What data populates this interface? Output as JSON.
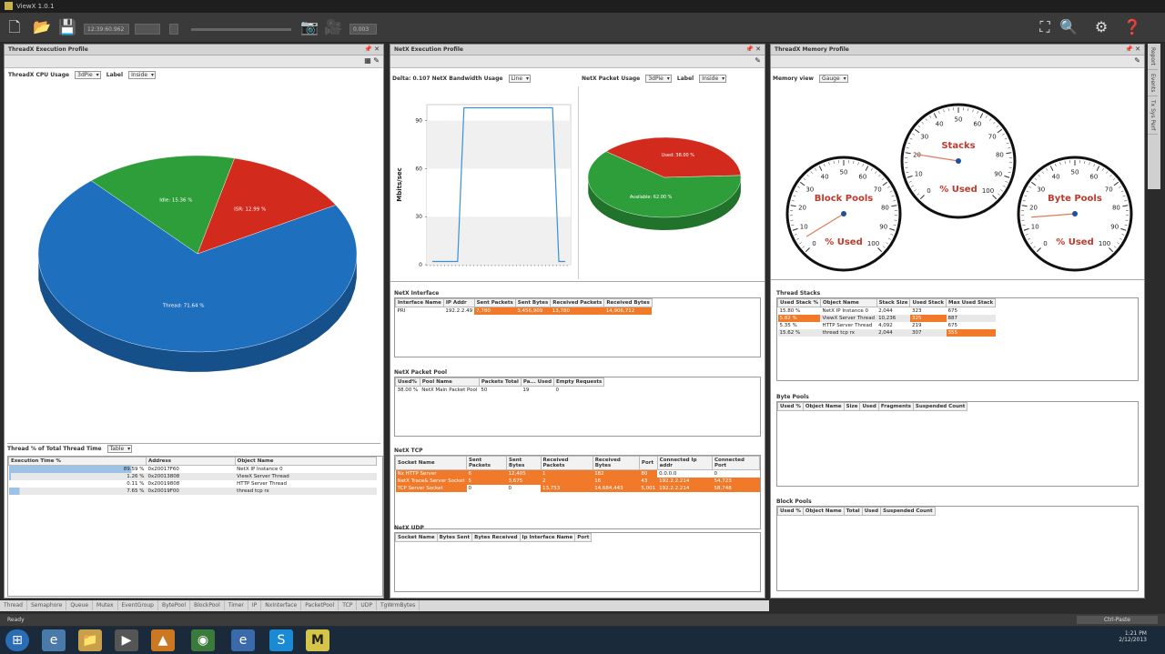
{
  "window": {
    "title": "ViewX 1.0.1"
  },
  "toolbar": {
    "field1": "12:39:60.962",
    "field2": "0.003"
  },
  "exec_panel": {
    "title": "ThreadX Execution Profile",
    "cpu_label": "ThreadX CPU Usage",
    "chart_type": "3dPie",
    "label_label": "Label",
    "label_value": "Inside",
    "pie": {
      "slices": [
        {
          "name": "Thread: 71.64 %",
          "value": 71.64,
          "color": "#1f6fbf"
        },
        {
          "name": "Idle: 15.36 %",
          "value": 15.36,
          "color": "#2e9e3a"
        },
        {
          "name": "ISR: 12.99 %",
          "value": 12.99,
          "color": "#d32a1e"
        }
      ]
    },
    "table_label": "Thread % of Total Thread Time",
    "table_type": "Table",
    "columns": [
      "Execution Time %",
      "Address",
      "Object Name"
    ],
    "rows": [
      [
        "89.59 %",
        "0x20017F60",
        "NetX IP Instance 0"
      ],
      [
        "1.26 %",
        "0x20013808",
        "ViewX Server Thread"
      ],
      [
        "0.11 %",
        "0x20019808",
        "HTTP Server Thread"
      ],
      [
        "7.65 %",
        "0x20019F00",
        "thread tcp rx"
      ]
    ]
  },
  "net_panel": {
    "title": "NetX Execution Profile",
    "delta": "Delta: 0.107",
    "bw_label": "NetX Bandwidth Usage",
    "bw_type": "Line",
    "ylabel": "Mbits/sec",
    "yticks": [
      "0",
      "30",
      "60",
      "90"
    ],
    "packet_label": "NetX Packet Usage",
    "packet_type": "3dPie",
    "label_label": "Label",
    "label_value": "Inside",
    "pie": {
      "slices": [
        {
          "name": "Available: 62.00 %",
          "value": 62.0,
          "color": "#2e9e3a"
        },
        {
          "name": "Used: 38.00 %",
          "value": 38.0,
          "color": "#d32a1e"
        }
      ]
    },
    "iface_title": "NetX Interface",
    "iface_cols": [
      "Interface Name",
      "IP Addr",
      "Sent Packets",
      "Sent Bytes",
      "Received Packets",
      "Received Bytes"
    ],
    "iface_row": [
      "PRI",
      "192.2.2.49",
      "7,780",
      "3,456,909",
      "13,780",
      "14,906,712"
    ],
    "pool_title": "NetX Packet Pool",
    "pool_cols": [
      "Used%",
      "Pool Name",
      "Packets Total",
      "Pa... Used",
      "Empty Requests"
    ],
    "pool_row": [
      "38.00 %",
      "NetX Main Packet Pool",
      "50",
      "19",
      "0"
    ],
    "tcp_title": "NetX TCP",
    "tcp_cols": [
      "Socket Name",
      "Sent Packets",
      "Sent Bytes",
      "Received Packets",
      "Received Bytes",
      "Port",
      "Connected Ip addr",
      "Connected Port"
    ],
    "tcp_rows": [
      [
        "Nx HTTP Server",
        "6",
        "12,405",
        "1",
        "182",
        "80",
        "0.0.0.0",
        "0"
      ],
      [
        "NetX Trace& Server Socket",
        "5",
        "3,675",
        "2",
        "16",
        "43",
        "192.2.2.214",
        "54,723"
      ],
      [
        "TCP Server Socket",
        "0",
        "0",
        "13,753",
        "14,684,443",
        "5,001",
        "192.2.2.214",
        "58,748"
      ]
    ],
    "udp_title": "NetX UDP",
    "udp_cols": [
      "Socket Name",
      "Bytes Sent",
      "Bytes Received",
      "Ip Interface Name",
      "Port"
    ]
  },
  "mem_panel": {
    "title": "ThreadX Memory Profile",
    "view_label": "Memory view",
    "view_type": "Gauge",
    "gauges": [
      {
        "name": "Block Pools",
        "unit": "% Used",
        "value": 5
      },
      {
        "name": "Stacks",
        "unit": "% Used",
        "value": 20
      },
      {
        "name": "Byte Pools",
        "unit": "% Used",
        "value": 15
      }
    ],
    "ticks": [
      "0",
      "10",
      "20",
      "30",
      "40",
      "50",
      "60",
      "70",
      "80",
      "90",
      "100"
    ],
    "stacks_title": "Thread Stacks",
    "stacks_cols": [
      "Used Stack %",
      "Object Name",
      "Stack Size",
      "Used Stack",
      "Max Used Stack"
    ],
    "stacks_rows": [
      [
        "15.80 %",
        "NetX IP Instance 0",
        "2,044",
        "323",
        "675"
      ],
      [
        "5.82 %",
        "ViewX Server Thread",
        "10,236",
        "325",
        "887"
      ],
      [
        "5.35 %",
        "HTTP Server Thread",
        "4,092",
        "219",
        "675"
      ],
      [
        "15.62 %",
        "thread tcp rx",
        "2,044",
        "307",
        "355"
      ]
    ],
    "byte_title": "Byte Pools",
    "byte_cols": [
      "Used %",
      "Object Name",
      "Size",
      "Used",
      "Fragments",
      "Suspended Count"
    ],
    "block_title": "Block Pools",
    "block_cols": [
      "Used %",
      "Object Name",
      "Total",
      "Used",
      "Suspended Count"
    ]
  },
  "side_tabs": [
    "Report",
    "Events",
    "Tx Sys Perf"
  ],
  "bottom_tabs": [
    "Thread",
    "Semaphore",
    "Queue",
    "Mutex",
    "EventGroup",
    "BytePool",
    "BlockPool",
    "Timer",
    "IP",
    "NxInterface",
    "PacketPool",
    "TCP",
    "UDP",
    "TgWrmBytes"
  ],
  "status": {
    "text": "Ready",
    "right": "Ctrl-Paste"
  },
  "taskbar": {
    "time": "1:21 PM",
    "date": "2/12/2013"
  },
  "chart_data": [
    {
      "type": "pie",
      "title": "ThreadX CPU Usage",
      "categories": [
        "Thread",
        "Idle",
        "ISR"
      ],
      "values": [
        71.64,
        15.36,
        12.99
      ]
    },
    {
      "type": "line",
      "title": "NetX Bandwidth Usage",
      "ylabel": "Mbits/sec",
      "ylim": [
        0,
        100
      ],
      "series": [
        {
          "values": [
            2,
            2,
            2,
            2,
            2,
            98,
            98,
            98,
            98,
            98,
            98,
            98,
            98,
            98,
            98,
            98,
            98,
            98,
            98,
            98,
            2,
            2
          ]
        }
      ]
    },
    {
      "type": "pie",
      "title": "NetX Packet Usage",
      "categories": [
        "Available",
        "Used"
      ],
      "values": [
        62.0,
        38.0
      ]
    }
  ]
}
